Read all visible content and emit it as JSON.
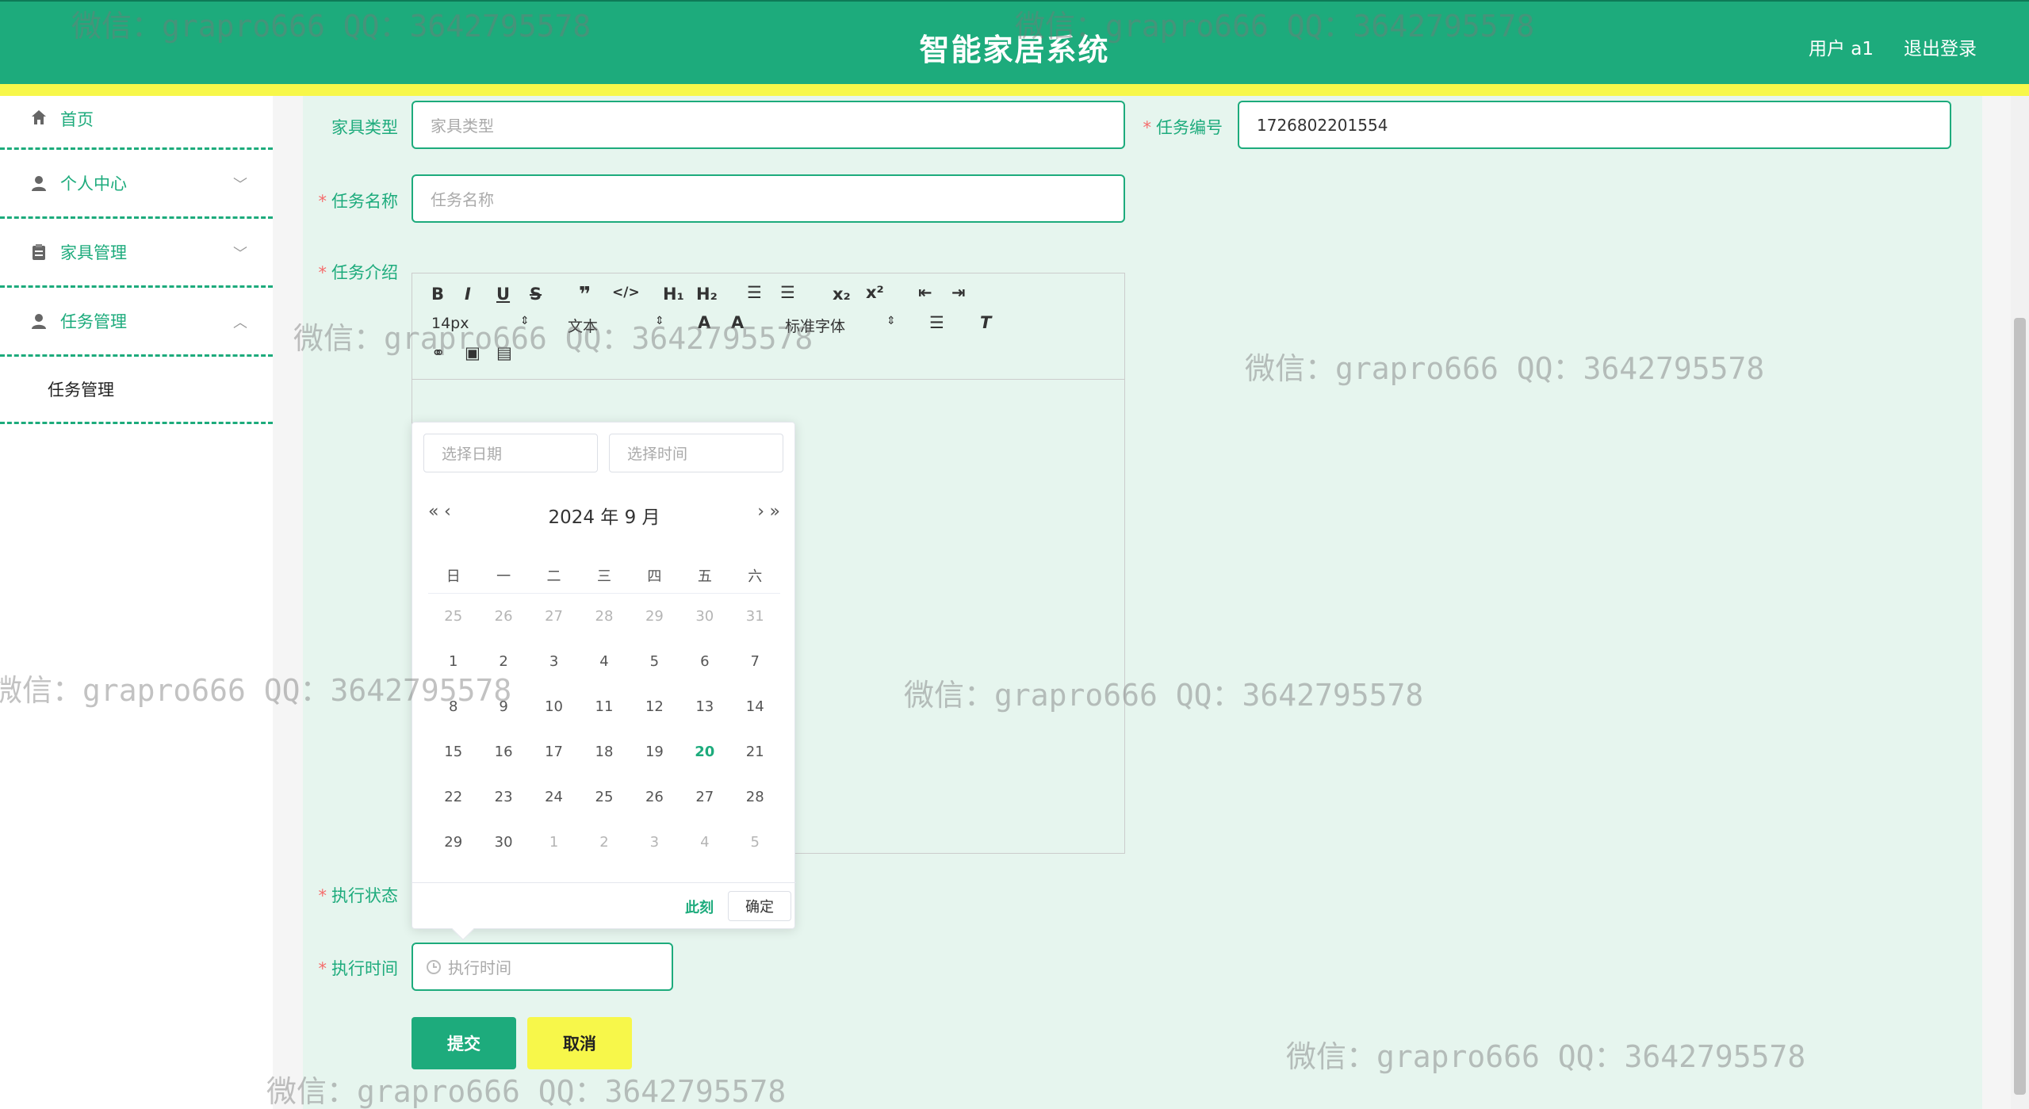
{
  "header": {
    "title": "智能家居系统",
    "user": "用户 a1",
    "logout": "退出登录"
  },
  "sidebar": {
    "items": [
      {
        "label": "首页"
      },
      {
        "label": "个人中心"
      },
      {
        "label": "家具管理"
      },
      {
        "label": "任务管理"
      }
    ],
    "sub_item": "任务管理"
  },
  "form": {
    "furniture_type": {
      "label": "家具类型",
      "placeholder": "家具类型"
    },
    "task_no": {
      "label": "任务编号",
      "value": "1726802201554"
    },
    "task_name": {
      "label": "任务名称",
      "placeholder": "任务名称"
    },
    "task_intro": {
      "label": "任务介绍"
    },
    "exec_status": {
      "label": "执行状态"
    },
    "exec_time": {
      "label": "执行时间",
      "placeholder": "执行时间"
    },
    "submit": "提交",
    "cancel": "取消"
  },
  "editor": {
    "font_size": "14px",
    "text_style": "文本",
    "font_family": "标准字体"
  },
  "datepicker": {
    "date_placeholder": "选择日期",
    "time_placeholder": "选择时间",
    "title": "2024 年  9 月",
    "weekdays": [
      "日",
      "一",
      "二",
      "三",
      "四",
      "五",
      "六"
    ],
    "weeks": [
      [
        "25",
        "26",
        "27",
        "28",
        "29",
        "30",
        "31"
      ],
      [
        "1",
        "2",
        "3",
        "4",
        "5",
        "6",
        "7"
      ],
      [
        "8",
        "9",
        "10",
        "11",
        "12",
        "13",
        "14"
      ],
      [
        "15",
        "16",
        "17",
        "18",
        "19",
        "20",
        "21"
      ],
      [
        "22",
        "23",
        "24",
        "25",
        "26",
        "27",
        "28"
      ],
      [
        "29",
        "30",
        "1",
        "2",
        "3",
        "4",
        "5"
      ]
    ],
    "today": "20",
    "now_label": "此刻",
    "ok_label": "确定"
  },
  "watermark": "微信：grapro666 QQ：3642795578",
  "colors": {
    "primary": "#1dab7c",
    "accent_yellow": "#f7f74a",
    "required": "#f56c6c"
  }
}
